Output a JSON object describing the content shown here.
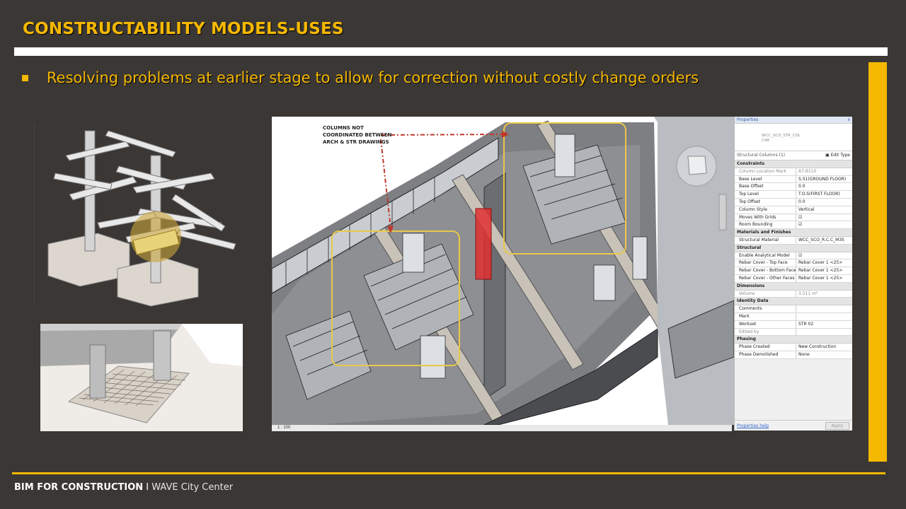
{
  "slide": {
    "title": "CONSTRUCTABILITY MODELS-USES",
    "bullet": "Resolving problems at earlier stage to allow for correction without costly change orders"
  },
  "annotation": {
    "line1": "COLUMNS NOT",
    "line2": "COORDINATED BETWEEN",
    "line3": "ARCH & STR DRAWINGS"
  },
  "properties_panel": {
    "header": "Properties",
    "close": "x",
    "type_name_1": "WCC_SCO_STR_COL",
    "type_name_2": "C98",
    "selector": "Structural Columns (1)",
    "edit_type": "Edit Type",
    "sections": [
      {
        "name": "Constraints",
        "rows": [
          {
            "k": "Column Location Mark",
            "v": "A7-B110",
            "grey": true
          },
          {
            "k": "Base Level",
            "v": "S.S1(GROUND FLOOR)"
          },
          {
            "k": "Base Offset",
            "v": "0.0"
          },
          {
            "k": "Top Level",
            "v": "T.O.S(FIRST FLOOR)"
          },
          {
            "k": "Top Offset",
            "v": "0.0"
          },
          {
            "k": "Column Style",
            "v": "Vertical"
          },
          {
            "k": "Moves With Grids",
            "v": "☑"
          },
          {
            "k": "Room Bounding",
            "v": "☑"
          }
        ]
      },
      {
        "name": "Materials and Finishes",
        "rows": [
          {
            "k": "Structural Material",
            "v": "WCC_SCO_R.C.C_M35"
          }
        ]
      },
      {
        "name": "Structural",
        "rows": [
          {
            "k": "Enable Analytical Model",
            "v": "☑"
          },
          {
            "k": "Rebar Cover - Top Face",
            "v": "Rebar Cover 1 <25>"
          },
          {
            "k": "Rebar Cover - Bottom Face",
            "v": "Rebar Cover 1 <25>"
          },
          {
            "k": "Rebar Cover - Other Faces",
            "v": "Rebar Cover 1 <25>"
          }
        ]
      },
      {
        "name": "Dimensions",
        "rows": [
          {
            "k": "Volume",
            "v": "3.511 m³",
            "grey": true
          }
        ]
      },
      {
        "name": "Identity Data",
        "rows": [
          {
            "k": "Comments",
            "v": ""
          },
          {
            "k": "Mark",
            "v": ""
          },
          {
            "k": "Workset",
            "v": "STR 02"
          },
          {
            "k": "Edited by",
            "v": "",
            "grey": true
          }
        ]
      },
      {
        "name": "Phasing",
        "rows": [
          {
            "k": "Phase Created",
            "v": "New Construction"
          },
          {
            "k": "Phase Demolished",
            "v": "None"
          }
        ]
      }
    ],
    "help_link": "Properties help",
    "apply_button": "Apply"
  },
  "statusbar": {
    "scale": "1 : 100"
  },
  "footer": {
    "bold": "BIM FOR CONSTRUCTION",
    "separator": "I",
    "rest": "WAVE City Center"
  },
  "colors": {
    "accent": "#f5b800",
    "background": "#3a3735",
    "highlight_red": "#e03030"
  }
}
